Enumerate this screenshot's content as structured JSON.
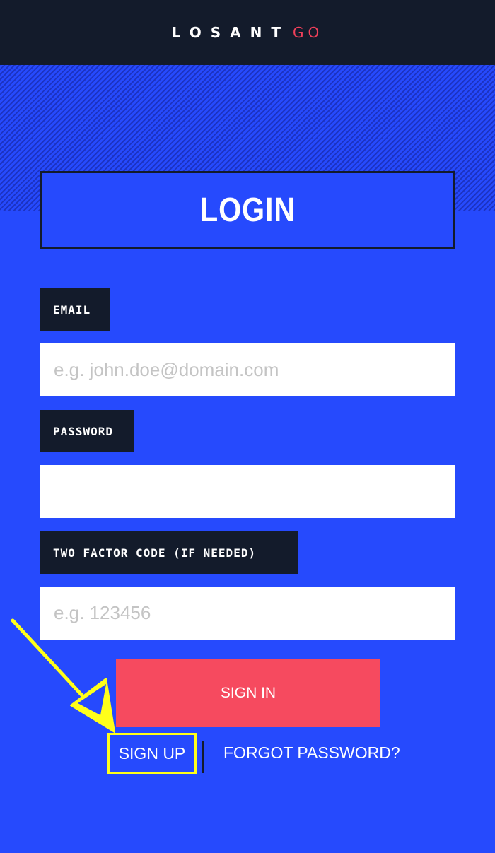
{
  "brand": {
    "word": "LOSANT",
    "suffix": "GO"
  },
  "login": {
    "title": "LOGIN"
  },
  "fields": {
    "email": {
      "label": "EMAIL",
      "placeholder": "e.g. john.doe@domain.com",
      "value": ""
    },
    "password": {
      "label": "PASSWORD",
      "placeholder": "",
      "value": ""
    },
    "two_factor": {
      "label": "TWO FACTOR CODE (IF NEEDED)",
      "placeholder": "e.g. 123456",
      "value": ""
    }
  },
  "actions": {
    "sign_in": "SIGN IN",
    "sign_up": "SIGN UP",
    "forgot": "FORGOT PASSWORD?"
  },
  "colors": {
    "header_bg": "#131b2b",
    "page_bg": "#264afd",
    "stripe": "#1c33c2",
    "accent": "#f64a5f",
    "highlight": "#ffff1a"
  },
  "annotation": {
    "arrow_icon": "arrow-down-right-icon",
    "highlight_target": "sign-up-link"
  }
}
